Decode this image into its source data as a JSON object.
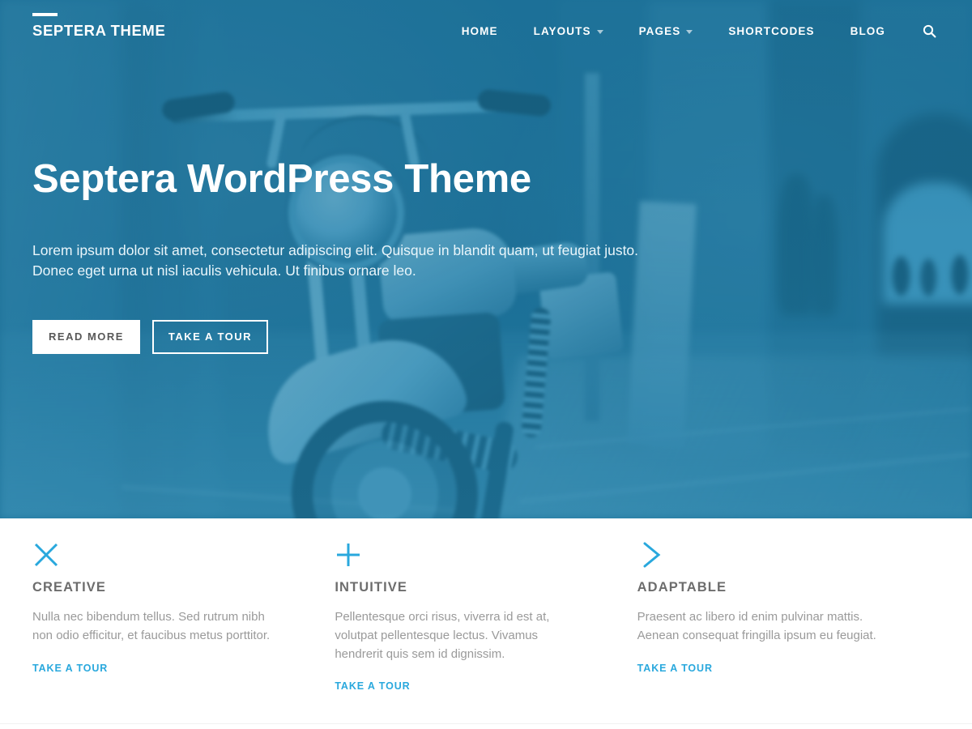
{
  "header": {
    "brand": "SEPTERA THEME",
    "nav": [
      {
        "label": "HOME",
        "has_dropdown": false
      },
      {
        "label": "LAYOUTS",
        "has_dropdown": true
      },
      {
        "label": "PAGES",
        "has_dropdown": true
      },
      {
        "label": "SHORTCODES",
        "has_dropdown": false
      },
      {
        "label": "BLOG",
        "has_dropdown": false
      }
    ],
    "search_icon": "search-icon"
  },
  "hero": {
    "title": "Septera WordPress Theme",
    "subtitle": "Lorem ipsum dolor sit amet, consectetur adipiscing elit. Quisque in blandit quam, ut feugiat justo. Donec eget urna ut nisl iaculis vehicula. Ut finibus ornare leo.",
    "primary_button": "READ MORE",
    "secondary_button": "TAKE A TOUR"
  },
  "features": [
    {
      "icon": "close-x-icon",
      "title": "CREATIVE",
      "text": "Nulla nec bibendum tellus. Sed rutrum nibh non odio efficitur, et faucibus metus porttitor.",
      "link": "TAKE A TOUR"
    },
    {
      "icon": "plus-icon",
      "title": "INTUITIVE",
      "text": "Pellentesque orci risus, viverra id est at, volutpat pellentesque lectus. Vivamus hendrerit quis sem id dignissim.",
      "link": "TAKE A TOUR"
    },
    {
      "icon": "chevron-right-icon",
      "title": "ADAPTABLE",
      "text": "Praesent ac libero id enim pulvinar mattis. Aenean consequat fringilla ipsum eu feugiat.",
      "link": "TAKE A TOUR"
    }
  ],
  "colors": {
    "hero_overlay": "#2e8db0",
    "accent": "#29a8dd",
    "heading_gray": "#6d6d6d",
    "body_gray": "#9a9a9a",
    "button_text": "#585858"
  }
}
